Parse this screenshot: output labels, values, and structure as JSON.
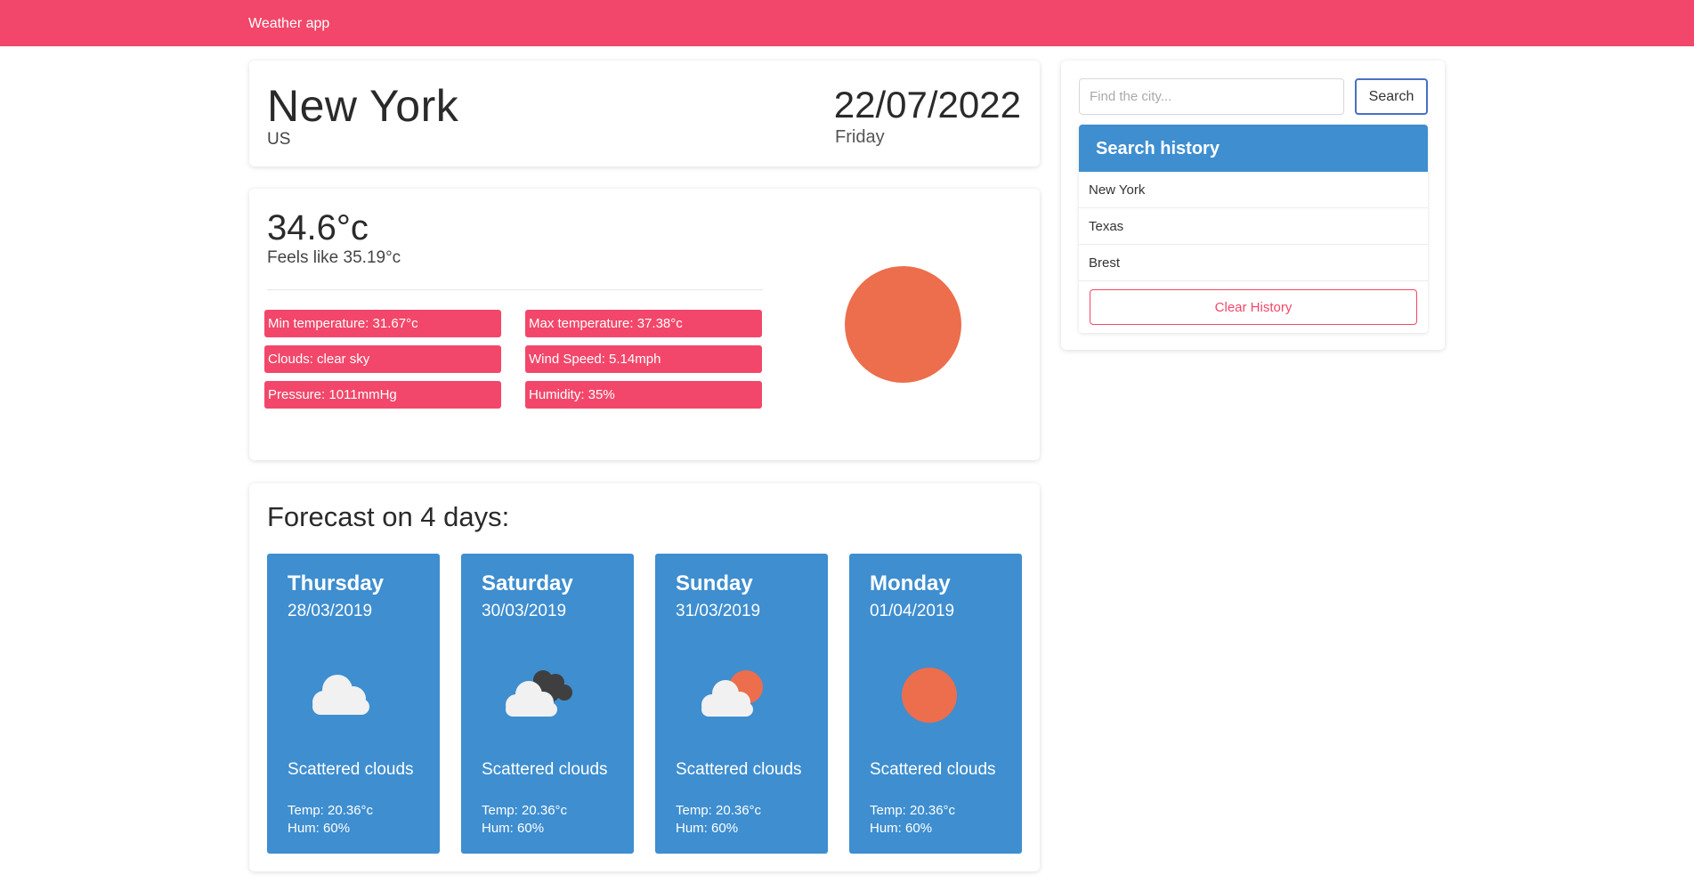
{
  "navbar": {
    "brand": "Weather app"
  },
  "location": {
    "city": "New York",
    "country": "US",
    "date": "22/07/2022",
    "weekday": "Friday"
  },
  "current": {
    "temperature": "34.6°c",
    "feels_like": "Feels like 35.19°c",
    "stats": {
      "min_temp": "Min temperature: 31.67°c",
      "max_temp": "Max temperature: 37.38°c",
      "clouds": "Clouds: clear sky",
      "wind": "Wind Speed: 5.14mph",
      "pressure": "Pressure: 1011mmHg",
      "humidity": "Humidity: 35%"
    },
    "icon": "sun-icon"
  },
  "forecast": {
    "title": "Forecast on 4 days:",
    "days": [
      {
        "day": "Thursday",
        "date": "28/03/2019",
        "description": "Scattered clouds",
        "temp": "Temp: 20.36°c",
        "hum": "Hum: 60%",
        "icon": "cloud-icon"
      },
      {
        "day": "Saturday",
        "date": "30/03/2019",
        "description": "Scattered clouds",
        "temp": "Temp: 20.36°c",
        "hum": "Hum: 60%",
        "icon": "cloud-dark-cloud-icon"
      },
      {
        "day": "Sunday",
        "date": "31/03/2019",
        "description": "Scattered clouds",
        "temp": "Temp: 20.36°c",
        "hum": "Hum: 60%",
        "icon": "cloud-sun-icon"
      },
      {
        "day": "Monday",
        "date": "01/04/2019",
        "description": "Scattered clouds",
        "temp": "Temp: 20.36°c",
        "hum": "Hum: 60%",
        "icon": "sun-icon"
      }
    ]
  },
  "search": {
    "placeholder": "Find the city...",
    "button_label": "Search"
  },
  "history": {
    "title": "Search history",
    "items": [
      "New York",
      "Texas",
      "Brest"
    ],
    "clear_label": "Clear History"
  },
  "colors": {
    "accent": "#f2476a",
    "blue": "#3e8ed0",
    "sun": "#ec6e4c",
    "cloud": "#f1f1f1",
    "dark_cloud": "#3f3f3f"
  }
}
